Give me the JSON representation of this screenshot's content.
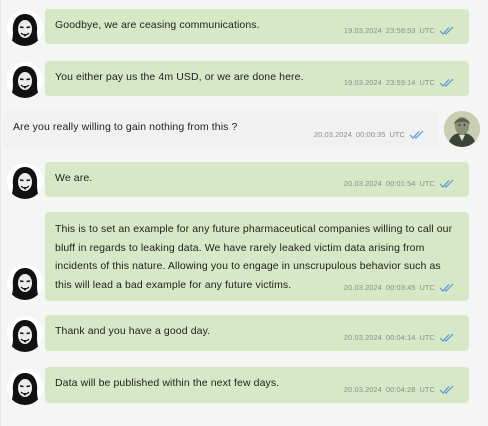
{
  "messages": [
    {
      "text": "Goodbye, we are ceasing communications.",
      "date": "19.03.2024",
      "time": "23:58:53",
      "tz": "UTC"
    },
    {
      "text": "You either pay us the 4m USD, or we are done here.",
      "date": "19.03.2024",
      "time": "23:59:14",
      "tz": "UTC"
    },
    {
      "text": "Are you really willing to gain nothing from this ?",
      "date": "20.03.2024",
      "time": "00:00:35",
      "tz": "UTC"
    },
    {
      "text": "We are.",
      "date": "20.03.2024",
      "time": "00:01:54",
      "tz": "UTC"
    },
    {
      "text": "This is to set an example for any future pharmaceutical companies willing to call our bluff in regards to leaking data. We have rarely leaked victim data arising from incidents of this nature. Allowing you to engage in unscrupulous behavior such as this will lead a bad example for any future victims.",
      "date": "20.03.2024",
      "time": "00:03:45",
      "tz": "UTC"
    },
    {
      "text": "Thank and you have a good day.",
      "date": "20.03.2024",
      "time": "00:04:14",
      "tz": "UTC"
    },
    {
      "text": "Data will be published within the next few days.",
      "date": "20.03.2024",
      "time": "00:04:28",
      "tz": "UTC"
    }
  ],
  "colors": {
    "incoming_bubble": "#d7e8c6",
    "outgoing_bubble": "#f1f1f1",
    "read_ticks": "#5b95d6"
  },
  "icons": {
    "attacker_avatar": "hooded-anonymous-mask-icon",
    "victim_avatar": "banknote-portrait-icon",
    "read_receipt": "double-check-icon"
  }
}
